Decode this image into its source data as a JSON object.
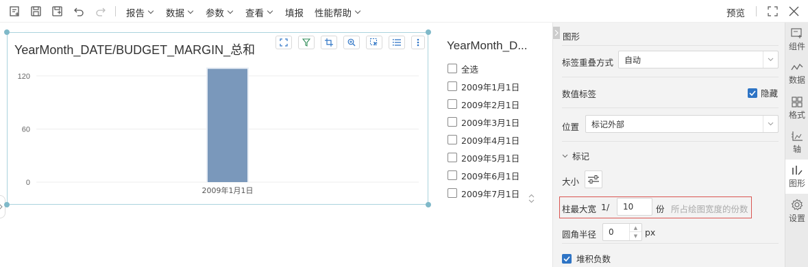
{
  "toolbar": {
    "menus": [
      "报告",
      "数据",
      "参数",
      "查看",
      "填报",
      "性能帮助"
    ],
    "preview": "预览"
  },
  "chart": {
    "title": "YearMonth_DATE/BUDGET_MARGIN_总和"
  },
  "chart_data": {
    "type": "bar",
    "categories": [
      "2009年1月1日"
    ],
    "values": [
      128
    ],
    "ylim": [
      0,
      130
    ],
    "yticks": [
      0,
      60,
      120
    ],
    "grid": true,
    "bar_color": "#7a98bb"
  },
  "filter": {
    "title": "YearMonth_D...",
    "items": [
      "全选",
      "2009年1月1日",
      "2009年2月1日",
      "2009年3月1日",
      "2009年4月1日",
      "2009年5月1日",
      "2009年6月1日",
      "2009年7月1日"
    ]
  },
  "panel": {
    "section_title": "图形",
    "label_overlap_label": "标签重叠方式",
    "label_overlap_value": "自动",
    "value_label": "数值标签",
    "hide_label": "隐藏",
    "position_label": "位置",
    "position_value": "标记外部",
    "marker_section": "标记",
    "size_label": "大小",
    "bar_max_width_label": "柱最大宽",
    "bar_max_width_prefix": "1/",
    "bar_max_width_value": "10",
    "bar_max_width_unit": "份",
    "bar_max_width_hint": "所占绘图宽度的份数",
    "corner_radius_label": "圆角半径",
    "corner_radius_value": "0",
    "corner_radius_unit": "px",
    "stack_negative_label": "堆积负数"
  },
  "sidetabs": [
    "组件",
    "数据",
    "格式",
    "轴",
    "图形",
    "设置"
  ],
  "colors": {
    "accent": "#2e74c5",
    "chart_border": "#a9d3dd",
    "highlight": "#d9534f"
  }
}
